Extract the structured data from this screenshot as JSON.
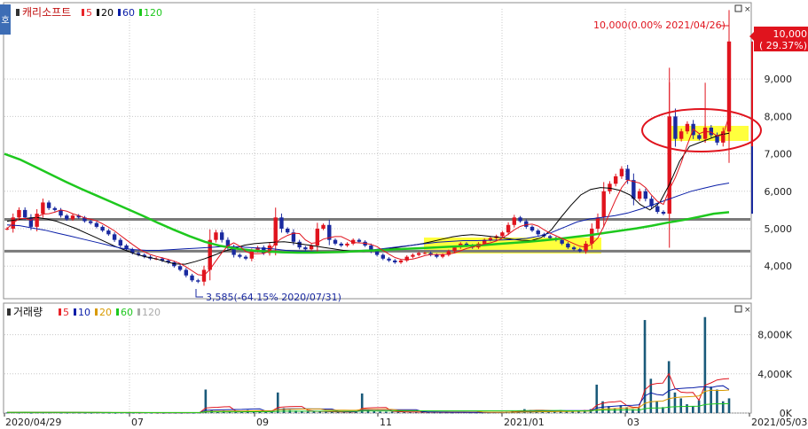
{
  "chart_data": [
    {
      "type": "candlestick",
      "panel": "price",
      "title": "캐리소프트",
      "legend": [
        {
          "label": "5",
          "color": "#e8242a"
        },
        {
          "label": "20",
          "color": "#000000"
        },
        {
          "label": "60",
          "color": "#0a1ea8"
        },
        {
          "label": "120",
          "color": "#1ec81e"
        }
      ],
      "y_axis": {
        "ticks": [
          "4,000",
          "5,000",
          "6,000",
          "7,000",
          "8,000",
          "9,000"
        ],
        "range": [
          3200,
          10400
        ]
      },
      "x_axis": {
        "ticks": [
          "2020/04/29",
          "07",
          "09",
          "11",
          "2021/01",
          "03",
          "2021/05/03"
        ]
      },
      "current_price_label": {
        "line1": "10,000",
        "line2": "( 29.37%)"
      },
      "high_annotation": "10,000(0.00% 2021/04/26)",
      "low_annotation": "3,585(-64.15% 2020/07/31)",
      "support_levels": [
        4400,
        5250
      ],
      "price_series": [
        [
          5000,
          5300,
          5500,
          5300,
          5050,
          5400,
          5700,
          5550,
          5500,
          5350,
          5250,
          5350,
          5300,
          5200,
          5150,
          5050,
          4950,
          4850,
          4700,
          4550,
          4450,
          4350,
          4300,
          4250,
          4200,
          4200,
          4150,
          4100,
          4000,
          3900,
          3750,
          3620,
          3585,
          3900,
          4700,
          4900,
          4700,
          4500,
          4300,
          4250,
          4200,
          4400,
          4500,
          4350,
          4550,
          5300,
          5000,
          4900,
          4650,
          4500,
          4450,
          4550,
          5000,
          5100,
          4700,
          4600,
          4550,
          4600,
          4700,
          4650,
          4550,
          4400,
          4300,
          4200,
          4150,
          4100,
          4150,
          4250,
          4300,
          4350,
          4350,
          4300,
          4250,
          4300,
          4400,
          4500,
          4600,
          4550,
          4500,
          4600,
          4700,
          4750,
          4800,
          4900,
          5100,
          5300,
          5200,
          5050,
          4950,
          4850,
          4800,
          4750,
          4700,
          4600,
          4500,
          4450,
          4400,
          4600,
          5000,
          5300,
          6000,
          6200,
          6400,
          6600,
          6300,
          5800,
          6000,
          5800,
          5600,
          5450,
          5400,
          8000,
          7400,
          7600,
          7800,
          7500,
          7400,
          7700,
          7500,
          7300,
          7600,
          10000
        ]
      ],
      "ma_lines": [
        {
          "period": "20",
          "values": [
            5200,
            5240,
            5280,
            5300,
            5260,
            5200,
            5100,
            5000,
            4880,
            4760,
            4640,
            4520,
            4420,
            4320,
            4250,
            4200,
            4120,
            4060,
            4050,
            4120,
            4200,
            4300,
            4400,
            4480,
            4560,
            4600,
            4620,
            4640,
            4650,
            4620,
            4580,
            4540,
            4500,
            4460,
            4420,
            4400,
            4390,
            4410,
            4440,
            4480,
            4520,
            4560,
            4600,
            4660,
            4720,
            4780,
            4820,
            4840,
            4820,
            4790,
            4760,
            4720,
            4690,
            4680,
            4760,
            4960,
            5300,
            5620,
            5900,
            6050,
            6100,
            6080,
            6020,
            5900,
            5650,
            5500,
            5700,
            6200,
            6800,
            7200,
            7300,
            7400,
            7500,
            7550
          ]
        },
        {
          "period": "60",
          "values": [
            5100,
            5080,
            5020,
            4960,
            4880,
            4800,
            4720,
            4640,
            4560,
            4480,
            4440,
            4420,
            4420,
            4440,
            4460,
            4480,
            4500,
            4520,
            4520,
            4500,
            4480,
            4460,
            4420,
            4400,
            4390,
            4380,
            4380,
            4400,
            4420,
            4440,
            4480,
            4520,
            4560,
            4600,
            4640,
            4660,
            4680,
            4680,
            4690,
            4700,
            4710,
            4740,
            4800,
            4900,
            5040,
            5180,
            5260,
            5300,
            5350,
            5420,
            5520,
            5640,
            5760,
            5880,
            6000,
            6080,
            6160,
            6220
          ]
        },
        {
          "period": "120",
          "values": [
            7000,
            6850,
            6650,
            6450,
            6250,
            6060,
            5880,
            5700,
            5520,
            5340,
            5150,
            4970,
            4800,
            4650,
            4540,
            4470,
            4420,
            4390,
            4370,
            4360,
            4360,
            4370,
            4380,
            4400,
            4420,
            4440,
            4460,
            4480,
            4500,
            4520,
            4540,
            4560,
            4590,
            4620,
            4650,
            4690,
            4730,
            4780,
            4830,
            4890,
            4950,
            5010,
            5080,
            5160,
            5230,
            5310,
            5400,
            5440
          ]
        }
      ]
    },
    {
      "type": "bar",
      "panel": "volume",
      "title": "거래량",
      "legend": [
        {
          "label": "5",
          "color": "#e8242a"
        },
        {
          "label": "10",
          "color": "#0a1ea8"
        },
        {
          "label": "20",
          "color": "#d89a00"
        },
        {
          "label": "60",
          "color": "#1ec81e"
        },
        {
          "label": "120",
          "color": "#aaaaaa"
        }
      ],
      "y_axis": {
        "ticks": [
          "0K",
          "4,000K",
          "8,000K"
        ],
        "range": [
          0,
          10500
        ]
      },
      "volume_series": [
        60,
        80,
        50,
        120,
        40,
        70,
        50,
        60,
        90,
        45,
        40,
        55,
        50,
        40,
        35,
        60,
        45,
        40,
        30,
        50,
        45,
        40,
        35,
        50,
        40,
        35,
        30,
        45,
        40,
        35,
        50,
        40,
        60,
        2400,
        300,
        150,
        250,
        180,
        140,
        120,
        300,
        220,
        180,
        150,
        200,
        2100,
        500,
        300,
        250,
        180,
        160,
        150,
        140,
        130,
        120,
        110,
        100,
        90,
        120,
        2000,
        300,
        200,
        150,
        140,
        130,
        120,
        110,
        100,
        90,
        90,
        80,
        70,
        60,
        70,
        60,
        80,
        90,
        70,
        60,
        50,
        60,
        80,
        100,
        150,
        200,
        250,
        400,
        300,
        250,
        200,
        180,
        200,
        300,
        250,
        200,
        180,
        300,
        400,
        2900,
        1200,
        700,
        500,
        800,
        600,
        400,
        500,
        9500,
        3500,
        1200,
        600,
        5300,
        2100,
        1500,
        900,
        700,
        1300,
        9800,
        2700,
        2400,
        1200,
        1500
      ]
    }
  ]
}
